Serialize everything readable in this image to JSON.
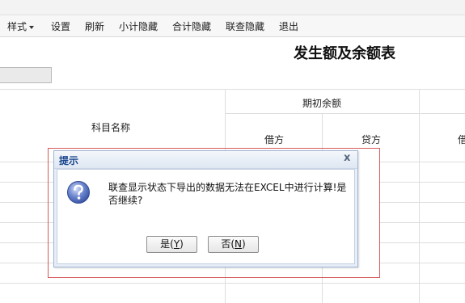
{
  "toolbar": {
    "items": [
      "样式",
      "设置",
      "刷新",
      "小计隐藏",
      "合计隐藏",
      "联查隐藏",
      "退出"
    ]
  },
  "report": {
    "title": "发生额及余额表",
    "headers": {
      "subject_name": "科目名称",
      "opening_balance": "期初余额",
      "debit": "借方",
      "credit": "贷方",
      "debit_cut": "借"
    }
  },
  "dialog": {
    "title": "提示",
    "close": "x",
    "message": "联查显示状态下导出的数据无法在EXCEL中进行计算!是否继续?",
    "yes": {
      "label": "是(",
      "key": "Y",
      "end": ")"
    },
    "no": {
      "label": "否(",
      "key": "N",
      "end": ")"
    }
  },
  "colors": {
    "dialog_title": "#15428b",
    "highlight_frame": "#d65a5a",
    "question_icon": "#3b57a8"
  }
}
